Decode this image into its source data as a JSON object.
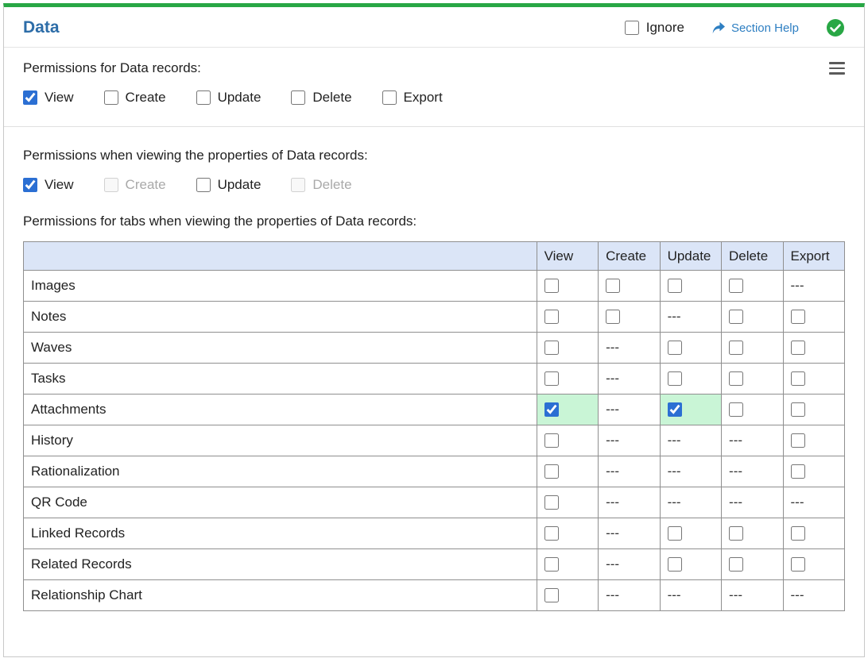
{
  "panel": {
    "title": "Data",
    "ignore_label": "Ignore",
    "section_help_label": "Section Help"
  },
  "sections": {
    "records": {
      "label": "Permissions for Data records:",
      "checkboxes": [
        {
          "label": "View",
          "checked": true,
          "disabled": false
        },
        {
          "label": "Create",
          "checked": false,
          "disabled": false
        },
        {
          "label": "Update",
          "checked": false,
          "disabled": false
        },
        {
          "label": "Delete",
          "checked": false,
          "disabled": false
        },
        {
          "label": "Export",
          "checked": false,
          "disabled": false
        }
      ]
    },
    "properties": {
      "label": "Permissions when viewing the properties of Data records:",
      "checkboxes": [
        {
          "label": "View",
          "checked": true,
          "disabled": false
        },
        {
          "label": "Create",
          "checked": false,
          "disabled": true
        },
        {
          "label": "Update",
          "checked": false,
          "disabled": false
        },
        {
          "label": "Delete",
          "checked": false,
          "disabled": true
        }
      ]
    },
    "tabs": {
      "label": "Permissions for tabs when viewing the properties of Data records:",
      "na_text": "---",
      "table": {
        "columns": [
          "View",
          "Create",
          "Update",
          "Delete",
          "Export"
        ],
        "rows": [
          {
            "name": "Images",
            "cells": [
              "unchecked",
              "unchecked",
              "unchecked",
              "unchecked",
              "na"
            ]
          },
          {
            "name": "Notes",
            "cells": [
              "unchecked",
              "unchecked",
              "na",
              "unchecked",
              "unchecked"
            ]
          },
          {
            "name": "Waves",
            "cells": [
              "unchecked",
              "na",
              "unchecked",
              "unchecked",
              "unchecked"
            ]
          },
          {
            "name": "Tasks",
            "cells": [
              "unchecked",
              "na",
              "unchecked",
              "unchecked",
              "unchecked"
            ]
          },
          {
            "name": "Attachments",
            "cells": [
              "checked",
              "na",
              "checked",
              "unchecked",
              "unchecked"
            ]
          },
          {
            "name": "History",
            "cells": [
              "unchecked",
              "na",
              "na",
              "na",
              "unchecked"
            ]
          },
          {
            "name": "Rationalization",
            "cells": [
              "unchecked",
              "na",
              "na",
              "na",
              "unchecked"
            ]
          },
          {
            "name": "QR Code",
            "cells": [
              "unchecked",
              "na",
              "na",
              "na",
              "na"
            ]
          },
          {
            "name": "Linked Records",
            "cells": [
              "unchecked",
              "na",
              "unchecked",
              "unchecked",
              "unchecked"
            ]
          },
          {
            "name": "Related Records",
            "cells": [
              "unchecked",
              "na",
              "unchecked",
              "unchecked",
              "unchecked"
            ]
          },
          {
            "name": "Relationship Chart",
            "cells": [
              "unchecked",
              "na",
              "na",
              "na",
              "na"
            ]
          }
        ]
      }
    }
  },
  "colors": {
    "title_blue": "#2d6da8",
    "link_blue": "#2e7fc2",
    "accent_green": "#28a745",
    "checkbox_blue": "#2b6fd3",
    "table_header_bg": "#dbe5f7",
    "checked_cell_bg": "#c9f5d6"
  }
}
